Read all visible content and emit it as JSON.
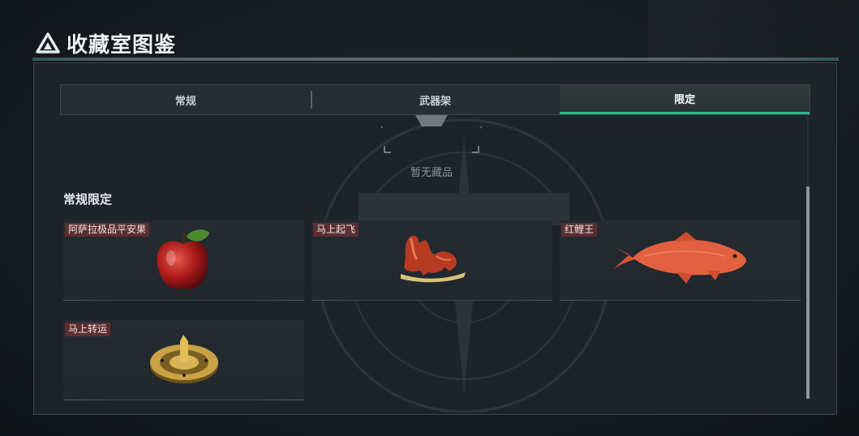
{
  "header": {
    "title": "收藏室图鉴",
    "logo_icon": "triangle-logo-icon"
  },
  "tabs": [
    {
      "label": "常规",
      "active": false
    },
    {
      "label": "武器架",
      "active": false
    },
    {
      "label": "限定",
      "active": true
    }
  ],
  "empty_state": {
    "text": "暂无藏品",
    "icon": "empty-collection-icon"
  },
  "section": {
    "title": "常规限定",
    "items": [
      {
        "label": "阿萨拉极品平安果",
        "icon": "apple-icon"
      },
      {
        "label": "马上起飞",
        "icon": "horse-statue-icon"
      },
      {
        "label": "红鲤王",
        "icon": "red-carp-icon"
      },
      {
        "label": "马上转运",
        "icon": "golden-wheel-icon"
      }
    ]
  },
  "colors": {
    "accent": "#2fb98a",
    "label_bg": "#5b2e31",
    "panel_bg": "#1c2329"
  }
}
